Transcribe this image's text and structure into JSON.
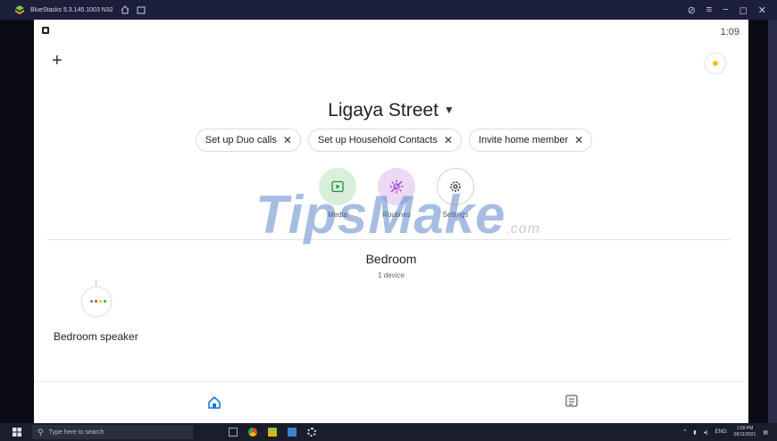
{
  "window": {
    "title": "BlueStacks 5.3.145.1003 N32"
  },
  "status": {
    "time": "1:09"
  },
  "home": {
    "name": "Ligaya Street"
  },
  "chips": [
    {
      "label": "Set up Duo calls"
    },
    {
      "label": "Set up Household Contacts"
    },
    {
      "label": "Invite home member"
    }
  ],
  "actions": {
    "media": "Media",
    "routines": "Routines",
    "settings": "Settings"
  },
  "room": {
    "title": "Bedroom",
    "subtitle": "1 device"
  },
  "device": {
    "name": "Bedroom speaker",
    "dot_colors": [
      "#4285f4",
      "#ea4335",
      "#fbbc05",
      "#34a853"
    ]
  },
  "watermark": {
    "main": "TipsMake",
    "suffix": ".com"
  },
  "taskbar": {
    "search_placeholder": "Type here to search",
    "lang": "ENG",
    "time": "1:09 PM",
    "date": "08/11/2021"
  },
  "colors": {
    "media_bg": "#d8efdc",
    "routines_bg": "#ecd9f3",
    "accent_blue": "#1a73e8"
  }
}
